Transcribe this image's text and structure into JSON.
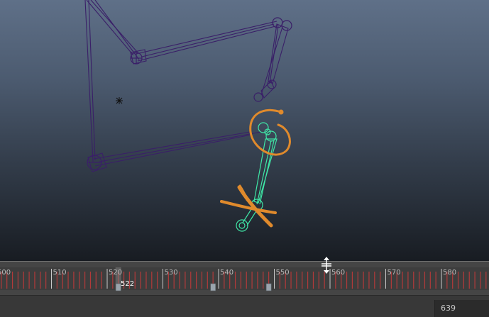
{
  "timeline": {
    "ticks": [
      "500",
      "510",
      "520",
      "530",
      "540",
      "550",
      "560",
      "570",
      "580"
    ],
    "current_frame": "522",
    "keyframes": [
      522,
      539,
      549
    ]
  },
  "range": {
    "end_value": "639"
  },
  "colors": {
    "rig_joint": "#3a1f68",
    "selected_joint": "#3fe6a6",
    "annotation": "#e08a2c",
    "tick_red": "#b23a3a",
    "keyframe": "#9aa4ac"
  },
  "icons": {
    "resize_cursor": "move-vertical-cursor-icon"
  }
}
